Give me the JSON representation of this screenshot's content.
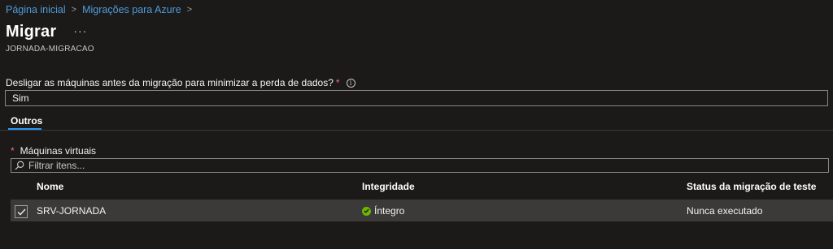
{
  "breadcrumb": {
    "items": [
      "Página inicial",
      "Migrações para Azure"
    ],
    "separator": ">"
  },
  "header": {
    "title": "Migrar",
    "more_label": "···",
    "subtitle": "JORNADA-MIGRACAO"
  },
  "shutdown": {
    "question": "Desligar as máquinas antes da migração para minimizar a perda de dados?",
    "required_mark": "*",
    "info_icon": "info-icon",
    "value": "Sim"
  },
  "tabs": [
    {
      "label": "Outros",
      "selected": true
    }
  ],
  "vms": {
    "label": "Máquinas virtuais",
    "required_mark": "*",
    "filter_placeholder": "Filtrar itens...",
    "columns": {
      "name": "Nome",
      "health": "Integridade",
      "test_status": "Status da migração de teste"
    },
    "rows": [
      {
        "checked": true,
        "name": "SRV-JORNADA",
        "health": "Íntegro",
        "health_icon": "healthy-check-icon",
        "test_status": "Nunca executado"
      }
    ]
  },
  "colors": {
    "background": "#1b1a19",
    "link": "#4f9bd9",
    "accent": "#2899f5",
    "required": "#f1707b",
    "healthy": "#6bb700",
    "row_selected": "#3b3a39"
  }
}
